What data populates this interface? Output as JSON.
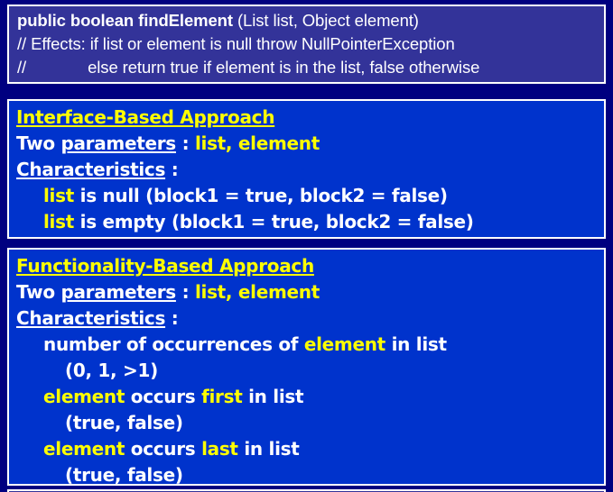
{
  "slide": {
    "background_color": "#000080",
    "accent_color": "#ffff00",
    "text_color": "#ffffff"
  },
  "signature": {
    "box_color": "#333399",
    "line1_bold": "public boolean findElement",
    "line1_rest": " (List list, Object element)",
    "line2": "// Effects: if list or element is null throw NullPointerException",
    "line3_prefix": "//",
    "line3_rest": "else return true if element is in the list, false otherwise"
  },
  "interface_approach": {
    "box_color": "#0033CC",
    "title": "Interface-Based Approach",
    "params_prefix": "Two ",
    "params_underlined": "parameters",
    "params_colon": " : ",
    "params_values": "list, element",
    "characteristics_label": "Characteristics",
    "characteristics_colon": " :",
    "items": [
      {
        "highlight": "list",
        "rest": " is null (block1 = true, block2 = false)"
      },
      {
        "highlight": "list",
        "rest": " is empty (block1 = true, block2 = false)"
      }
    ]
  },
  "functionality_approach": {
    "box_color": "#0033CC",
    "title": "Functionality-Based Approach",
    "params_prefix": "Two ",
    "params_underlined": "parameters",
    "params_colon": " : ",
    "params_values": "list, element",
    "characteristics_label": "Characteristics",
    "characteristics_colon": " :",
    "items": [
      {
        "pre": "number of occurrences of ",
        "highlight": "element",
        "post": " in list",
        "values": "(0, 1, >1)"
      },
      {
        "pre": "",
        "highlight": "element",
        "post": " occurs ",
        "highlight2": "first",
        "post2": " in list",
        "values": "(true, false)"
      },
      {
        "pre": "",
        "highlight": "element",
        "post": " occurs ",
        "highlight2": "last",
        "post2": " in list",
        "values": "(true, false)"
      }
    ]
  }
}
